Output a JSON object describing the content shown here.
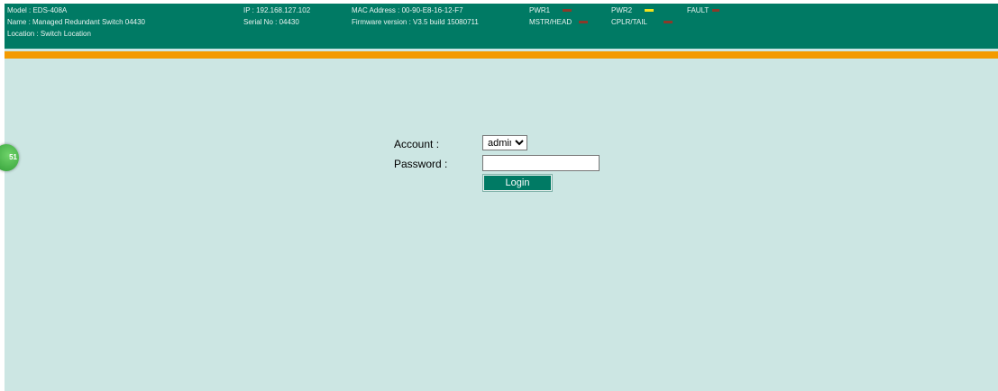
{
  "header": {
    "model": "Model : EDS-408A",
    "name": "Name : Managed Redundant Switch 04430",
    "location": "Location : Switch Location",
    "ip": "IP : 192.168.127.102",
    "serial": "Serial No : 04430",
    "mac": "MAC Address : 00-90-E8-16-12-F7",
    "firmware": "Firmware version : V3.5 build 15080711",
    "indicators": [
      {
        "label": "PWR1",
        "color": "#8a3a2a"
      },
      {
        "label": "PWR2",
        "color": "#f2e21c"
      },
      {
        "label": "FAULT",
        "color": "#8a3a2a"
      },
      {
        "label": "MSTR/HEAD",
        "color": "#8a3a2a"
      },
      {
        "label": "CPLR/TAIL",
        "color": "#8a3a2a"
      }
    ]
  },
  "side_badge": {
    "text": "51"
  },
  "login": {
    "account_label": "Account :",
    "account_options": [
      "admin"
    ],
    "account_selected": "admin",
    "password_label": "Password :",
    "password_value": "",
    "login_button": "Login"
  },
  "colors": {
    "header_bg": "#007a64",
    "accent_bar": "#f39a00",
    "page_bg": "#cce6e3",
    "button_bg": "#007a64"
  }
}
